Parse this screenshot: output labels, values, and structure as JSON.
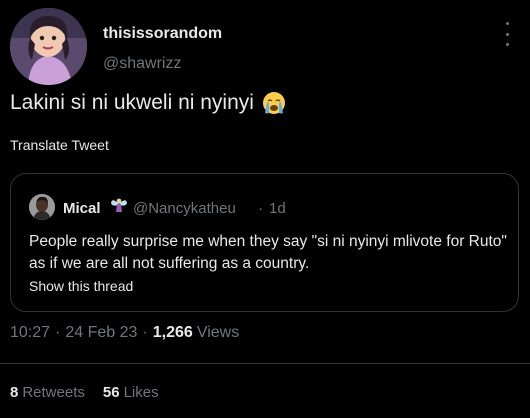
{
  "tweet": {
    "display_name": "thisissorandom",
    "handle": "@shawrizz",
    "text": "Lakini si ni ukweli ni nyinyi",
    "emoji": "loudly-crying-face",
    "translate_label": "Translate Tweet",
    "time": "10:27",
    "date": "24 Feb 23",
    "views_count": "1,266",
    "views_label": "Views",
    "retweets_count": "8",
    "retweets_label": "Retweets",
    "likes_count": "56",
    "likes_label": "Likes"
  },
  "quote": {
    "display_name": "Mical",
    "name_emoji": "fairy",
    "handle": "@Nancykatheu",
    "separator": "·",
    "time": "1d",
    "text": "People really surprise me when they say \"si ni nyinyi mlivote for Ruto\" as if we are all not suffering as a country.",
    "show_thread_label": "Show this thread"
  },
  "meta_separator": "·",
  "colors": {
    "background": "#000000",
    "primary_text": "#e7e9ea",
    "secondary_text": "#71767b",
    "border": "#2f3336"
  }
}
